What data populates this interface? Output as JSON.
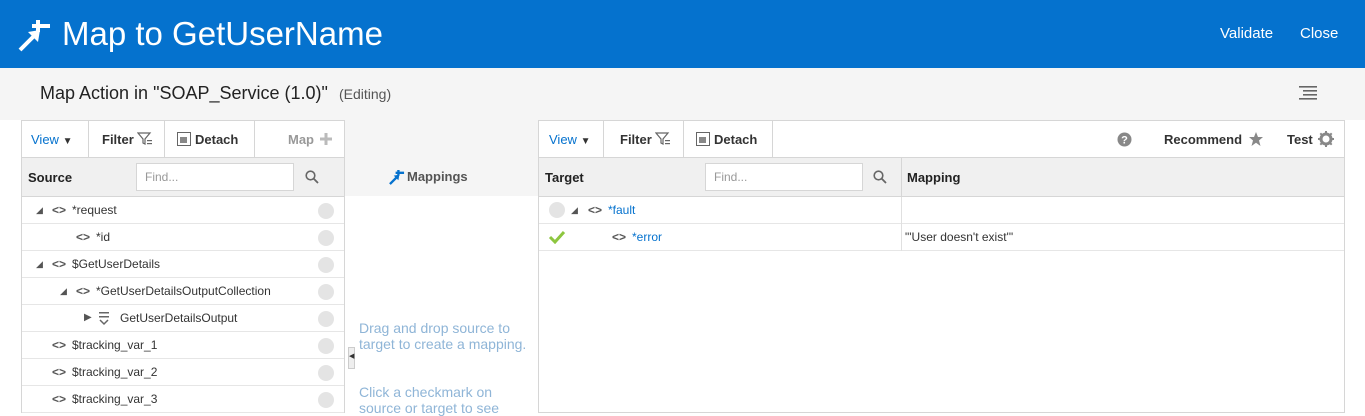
{
  "header": {
    "title": "Map to GetUserName",
    "validate": "Validate",
    "close": "Close"
  },
  "subheader": {
    "title": "Map Action in \"SOAP_Service (1.0)\"",
    "status": "(Editing)"
  },
  "left_panel": {
    "toolbar": {
      "view": "View",
      "filter": "Filter",
      "detach": "Detach",
      "map": "Map"
    },
    "column": "Source",
    "find_placeholder": "Find...",
    "rows": [
      {
        "label": "*request"
      },
      {
        "label": "*id"
      },
      {
        "label": "$GetUserDetails"
      },
      {
        "label": "*GetUserDetailsOutputCollection"
      },
      {
        "label": "GetUserDetailsOutput"
      },
      {
        "label": "$tracking_var_1"
      },
      {
        "label": "$tracking_var_2"
      },
      {
        "label": "$tracking_var_3"
      }
    ]
  },
  "middle_panel": {
    "title": "Mappings",
    "hint1": "Drag and drop source to target to create a mapping.",
    "hint2": "Click a checkmark on source or target to see"
  },
  "right_panel": {
    "toolbar": {
      "view": "View",
      "filter": "Filter",
      "detach": "Detach",
      "recommend": "Recommend",
      "test": "Test"
    },
    "column_target": "Target",
    "column_mapping": "Mapping",
    "find_placeholder": "Find...",
    "rows": [
      {
        "label": "*fault",
        "mapping": ""
      },
      {
        "label": "*error",
        "mapping": "\"'User doesn't exist'\""
      }
    ]
  },
  "colors": {
    "brand": "#0572ce",
    "link": "#0572ce",
    "check": "#8dc63f"
  },
  "icons": [
    "mapper-icon",
    "menu-icon",
    "filter-icon",
    "detach-icon",
    "plus-icon",
    "search-icon",
    "help-icon",
    "star-icon",
    "gear-icon",
    "check-icon",
    "collection-icon"
  ]
}
